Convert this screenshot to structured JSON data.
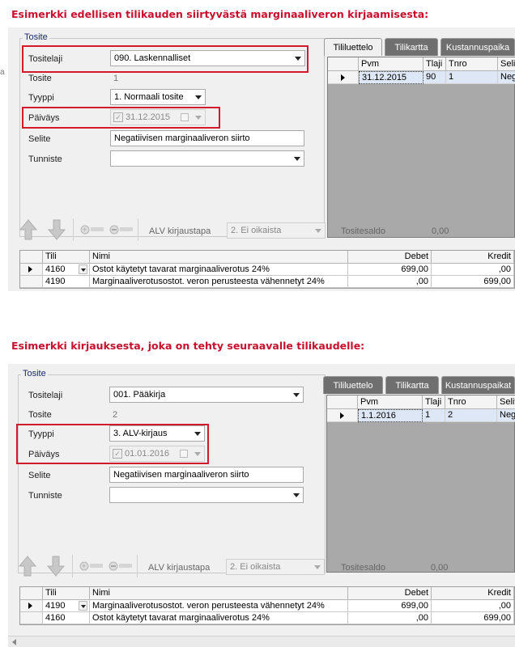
{
  "captions": {
    "first": "Esimerkki edellisen tilikauden siirtyvästä marginaaliveron kirjaamisesta:",
    "second": "Esimerkki kirjauksesta, joka on tehty seuraavalle tilikaudelle:"
  },
  "left_edge_char": "a",
  "example1": {
    "group_title": "Tosite",
    "labels": {
      "tositelaji": "Tositelaji",
      "tosite": "Tosite",
      "tyyppi": "Tyyppi",
      "paivays": "Päiväys",
      "selite": "Selite",
      "tunniste": "Tunniste"
    },
    "values": {
      "tositelaji": "090. Laskennalliset",
      "tosite": "1",
      "tyyppi": "1. Normaali tosite",
      "paivays": "31.12.2015",
      "selite": "Negatiivisen marginaaliveron siirto",
      "tunniste": ""
    },
    "tabs": [
      "Tililuettelo",
      "Tilikartta",
      "Kustannuspaika"
    ],
    "grid_headers": [
      "Pvm",
      "Tlaji",
      "Tnro",
      "Selit"
    ],
    "grid_row": [
      "31.12.2015",
      "90",
      "1",
      "Neg"
    ],
    "toolbar": {
      "alv_label": "ALV kirjaustapa",
      "alv_value": "2. Ei oikaista",
      "saldo_label": "Tositesaldo",
      "saldo_value": "0,00"
    },
    "entries_headers": {
      "tili": "Tili",
      "nimi": "Nimi",
      "debet": "Debet",
      "kredit": "Kredit"
    },
    "entries": [
      {
        "tili": "4160",
        "nimi": "Ostot käytetyt tavarat marginaaliverotus 24%",
        "debet": "699,00",
        "kredit": ",00"
      },
      {
        "tili": "4190",
        "nimi": "Marginaaliverotusostot. veron perusteesta vähennetyt 24%",
        "debet": ",00",
        "kredit": "699,00"
      }
    ]
  },
  "example2": {
    "group_title": "Tosite",
    "labels": {
      "tositelaji": "Tositelaji",
      "tosite": "Tosite",
      "tyyppi": "Tyyppi",
      "paivays": "Päiväys",
      "selite": "Selite",
      "tunniste": "Tunniste"
    },
    "values": {
      "tositelaji": "001. Pääkirja",
      "tosite": "2",
      "tyyppi": "3. ALV-kirjaus",
      "paivays": "01.01.2016",
      "selite": "Negatiivisen marginaaliveron siirto",
      "tunniste": ""
    },
    "tabs": [
      "Tililuettelo",
      "Tilikartta",
      "Kustannuspaikat"
    ],
    "grid_headers": [
      "Pvm",
      "Tlaji",
      "Tnro",
      "Selit"
    ],
    "grid_row": [
      "1.1.2016",
      "1",
      "2",
      "Neg"
    ],
    "toolbar": {
      "alv_label": "ALV kirjaustapa",
      "alv_value": "2. Ei oikaista",
      "saldo_label": "Tositesaldo",
      "saldo_value": "0,00"
    },
    "entries_headers": {
      "tili": "Tili",
      "nimi": "Nimi",
      "debet": "Debet",
      "kredit": "Kredit"
    },
    "entries": [
      {
        "tili": "4190",
        "nimi": "Marginaaliverotusostot. veron perusteesta vähennetyt 24%",
        "debet": "699,00",
        "kredit": ",00"
      },
      {
        "tili": "4160",
        "nimi": "Ostot käytetyt tavarat marginaaliverotus 24%",
        "debet": ",00",
        "kredit": "699,00"
      }
    ]
  },
  "colors": {
    "caption": "#c8102e",
    "highlight": "#d21a2a",
    "selected_row": "#dde7f5"
  }
}
